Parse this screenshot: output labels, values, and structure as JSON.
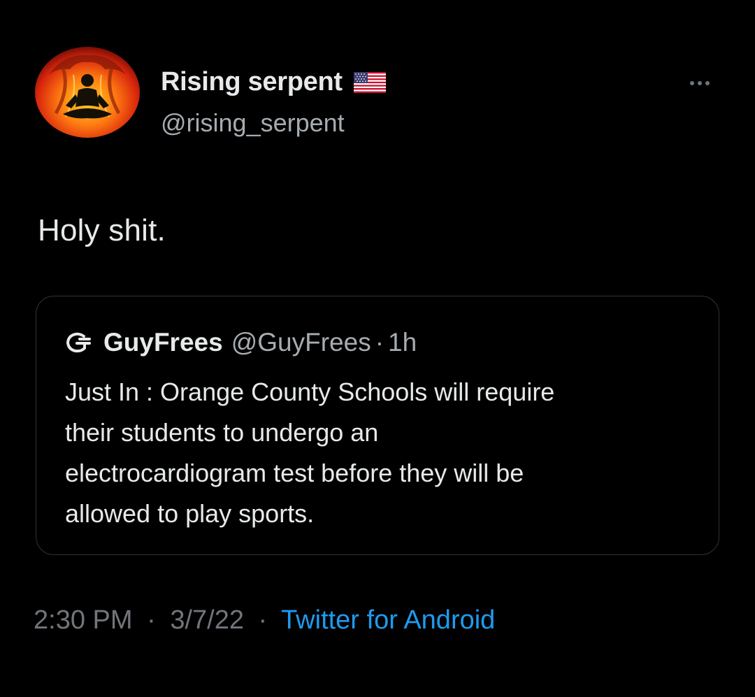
{
  "author": {
    "display_name": "Rising serpent",
    "handle": "@rising_serpent",
    "badge_icon": "us-flag-icon",
    "avatar_icon": "meditating-figure-avatar-icon"
  },
  "tweet": {
    "text": "Holy shit."
  },
  "quoted_tweet": {
    "avatar_icon": "guyfrees-logo-icon",
    "display_name": "GuyFrees",
    "handle": "@GuyFrees",
    "separator": "·",
    "time": "1h",
    "text_lines": [
      "Just In : Orange County Schools will require",
      "their students to undergo an",
      "electrocardiogram test before they will be",
      "allowed to play sports."
    ]
  },
  "meta": {
    "time": "2:30 PM",
    "date": "3/7/22",
    "separator": "·",
    "source": "Twitter for Android"
  },
  "colors": {
    "background": "#000000",
    "primary_text": "#e7e9ea",
    "secondary_text": "#71767b",
    "link": "#1d9bf0",
    "border": "#2f3336"
  }
}
